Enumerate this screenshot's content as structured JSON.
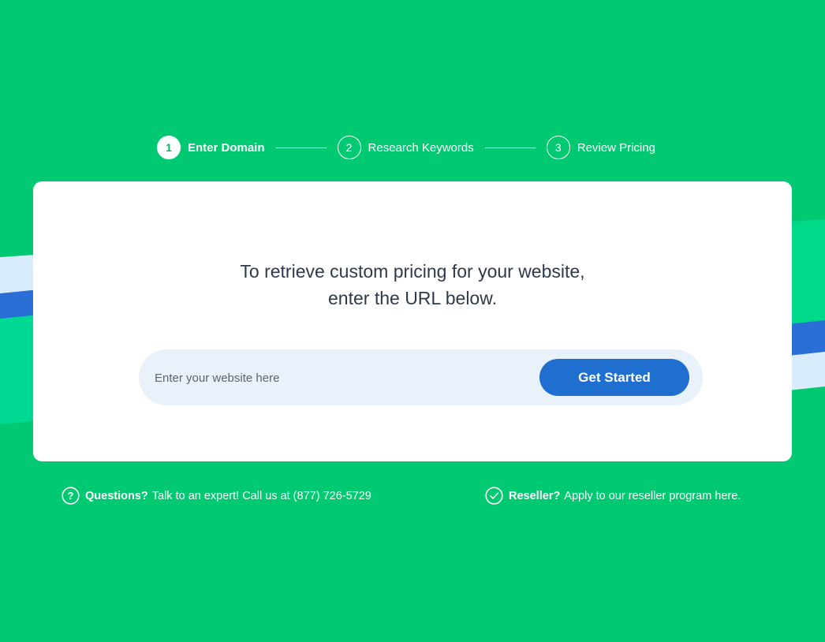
{
  "colors": {
    "background": "#00c971",
    "card": "#ffffff",
    "button": "#1f6fd0",
    "input_bg": "#e9f1fb",
    "headline": "#2e3a4b"
  },
  "steps": [
    {
      "number": "1",
      "label": "Enter Domain",
      "active": true
    },
    {
      "number": "2",
      "label": "Research Keywords",
      "active": false
    },
    {
      "number": "3",
      "label": "Review Pricing",
      "active": false
    }
  ],
  "card": {
    "headline_line1": "To retrieve custom pricing for your website,",
    "headline_line2": "enter the URL below.",
    "search": {
      "placeholder": "Enter your website here",
      "value": ""
    },
    "button_label": "Get Started"
  },
  "footer": {
    "questions": {
      "icon": "question-circle-icon",
      "bold": "Questions?",
      "text": "Talk to an expert! Call us at (877) 726-5729"
    },
    "reseller": {
      "icon": "check-circle-icon",
      "bold": "Reseller?",
      "text": "Apply to our reseller program here."
    }
  }
}
